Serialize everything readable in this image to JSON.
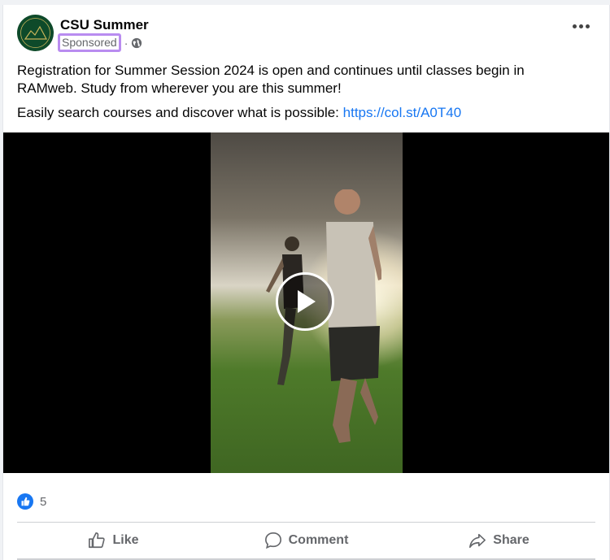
{
  "post": {
    "page_name": "CSU Summer",
    "sponsored_label": "Sponsored",
    "separator": "·",
    "avatar_text": "CSU Summer",
    "body_line1": "Registration for Summer Session 2024 is open and continues until classes begin in RAMweb. Study from wherever you are this summer!",
    "body_line2_prefix": "Easily search courses and discover what is possible: ",
    "body_link": "https://col.st/A0T40"
  },
  "reactions": {
    "count": "5"
  },
  "actions": {
    "like": "Like",
    "comment": "Comment",
    "share": "Share"
  },
  "colors": {
    "accent": "#1877f2",
    "sponsored_highlight": "#b98cf0",
    "muted": "#65676b"
  },
  "icons": [
    "globe-icon",
    "more-options-icon",
    "play-icon",
    "like-icon",
    "comment-icon",
    "share-icon"
  ]
}
